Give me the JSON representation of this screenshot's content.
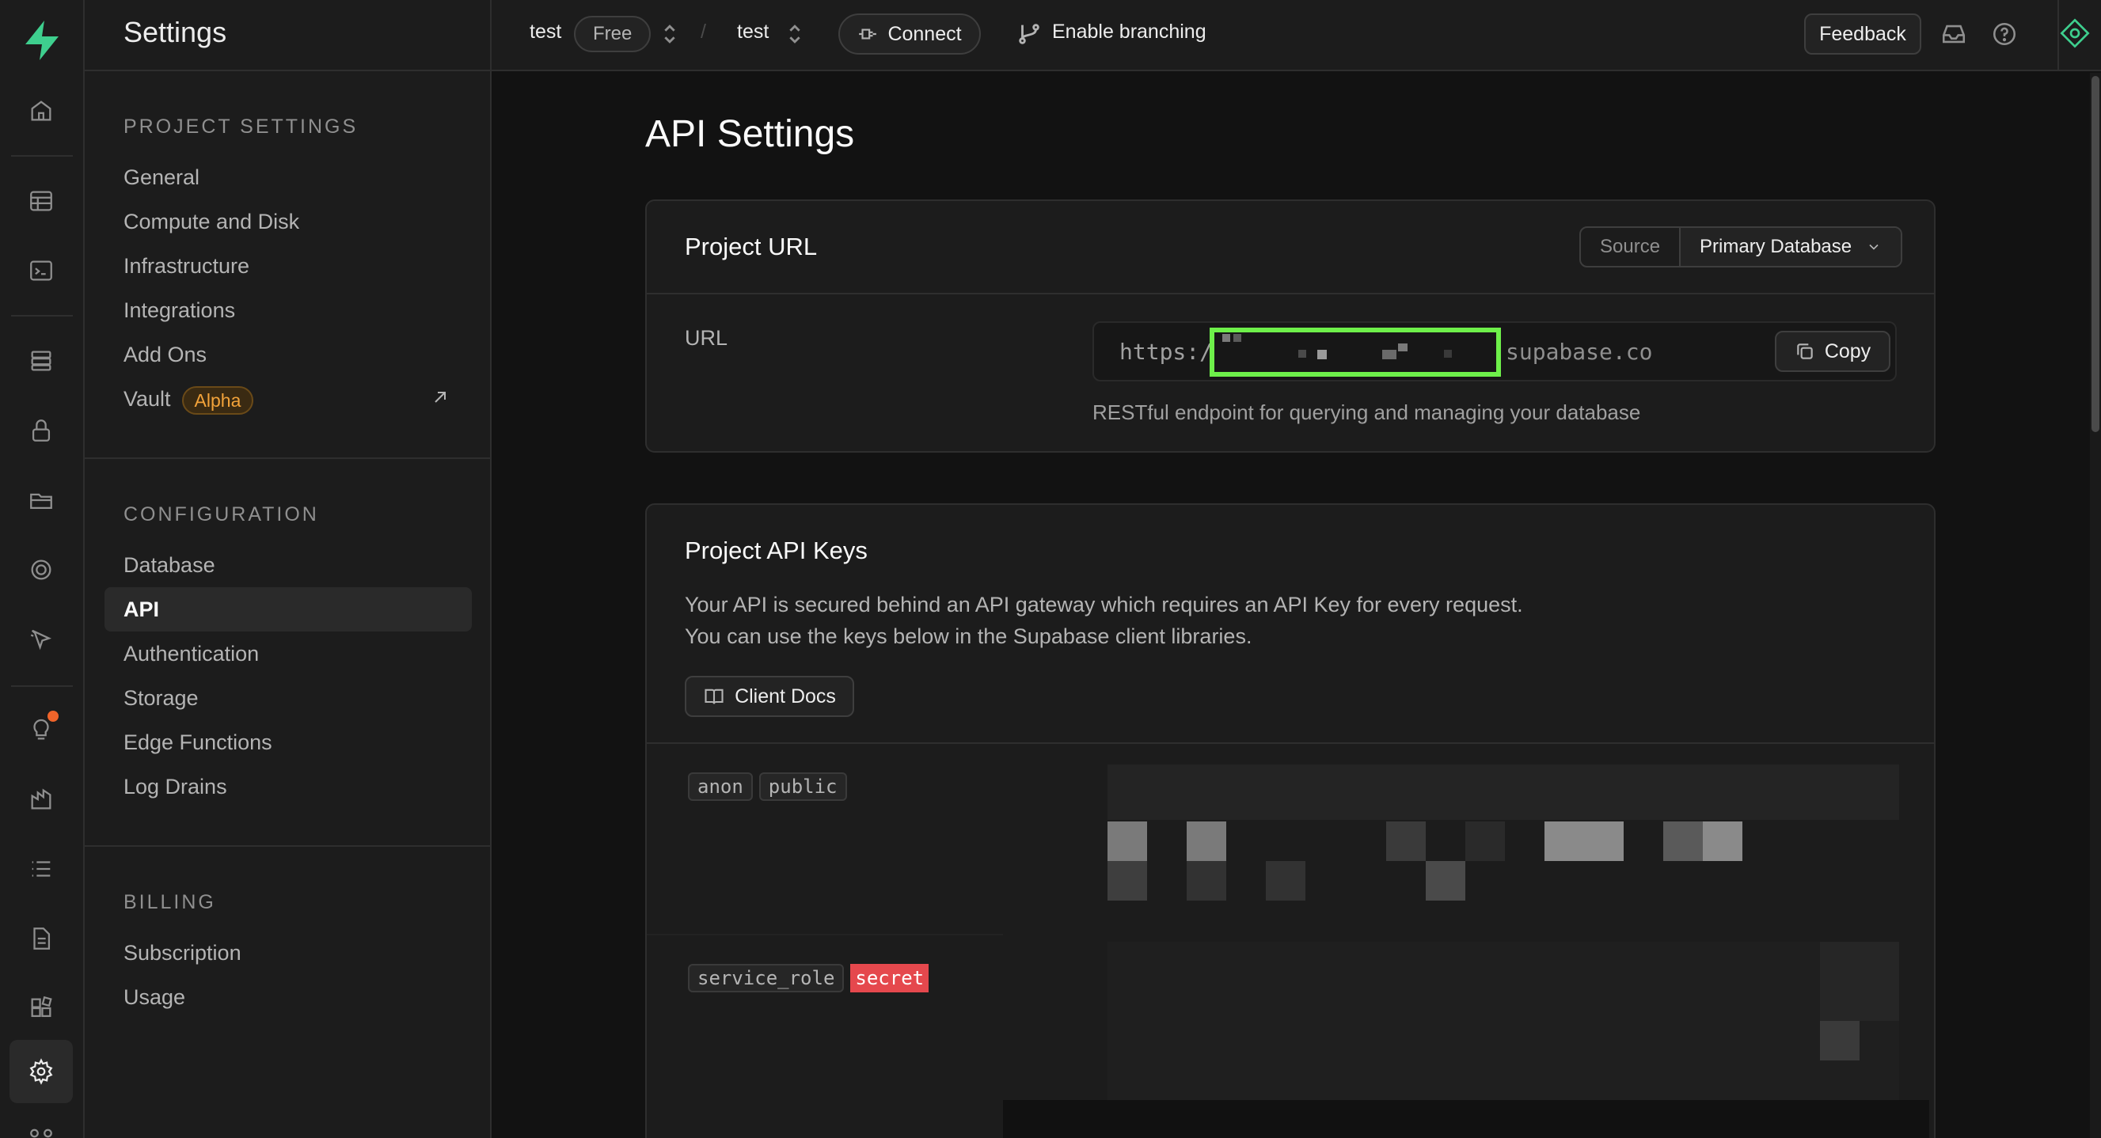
{
  "sidebar": {
    "title": "Settings",
    "sections": [
      {
        "heading": "PROJECT SETTINGS",
        "items": [
          {
            "label": "General"
          },
          {
            "label": "Compute and Disk"
          },
          {
            "label": "Infrastructure"
          },
          {
            "label": "Integrations"
          },
          {
            "label": "Add Ons"
          },
          {
            "label": "Vault",
            "badge": "Alpha"
          }
        ]
      },
      {
        "heading": "CONFIGURATION",
        "items": [
          {
            "label": "Database"
          },
          {
            "label": "API",
            "active": true
          },
          {
            "label": "Authentication"
          },
          {
            "label": "Storage"
          },
          {
            "label": "Edge Functions"
          },
          {
            "label": "Log Drains"
          }
        ]
      },
      {
        "heading": "BILLING",
        "items": [
          {
            "label": "Subscription"
          },
          {
            "label": "Usage"
          }
        ]
      }
    ]
  },
  "topbar": {
    "org": "test",
    "plan": "Free",
    "separator": "/",
    "project": "test",
    "connect": "Connect",
    "branching": "Enable branching",
    "feedback": "Feedback"
  },
  "page": {
    "title": "API Settings",
    "project_url": {
      "title": "Project URL",
      "source_label": "Source",
      "source_value": "Primary Database",
      "field_label": "URL",
      "url_prefix": "https:/",
      "url_suffix": "supabase.co",
      "copy": "Copy",
      "help": "RESTful endpoint for querying and managing your database"
    },
    "api_keys": {
      "title": "Project API Keys",
      "line1": "Your API is secured behind an API gateway which requires an API Key for every request.",
      "line2": "You can use the keys below in the Supabase client libraries.",
      "docs": "Client Docs",
      "anon_tags": [
        "anon",
        "public"
      ],
      "service_tags": [
        "service_role",
        "secret"
      ]
    }
  },
  "colors": {
    "accent": "#3ecf8e",
    "highlight": "#6ef04a",
    "danger": "#e5484d",
    "notification": "#f0642a"
  }
}
